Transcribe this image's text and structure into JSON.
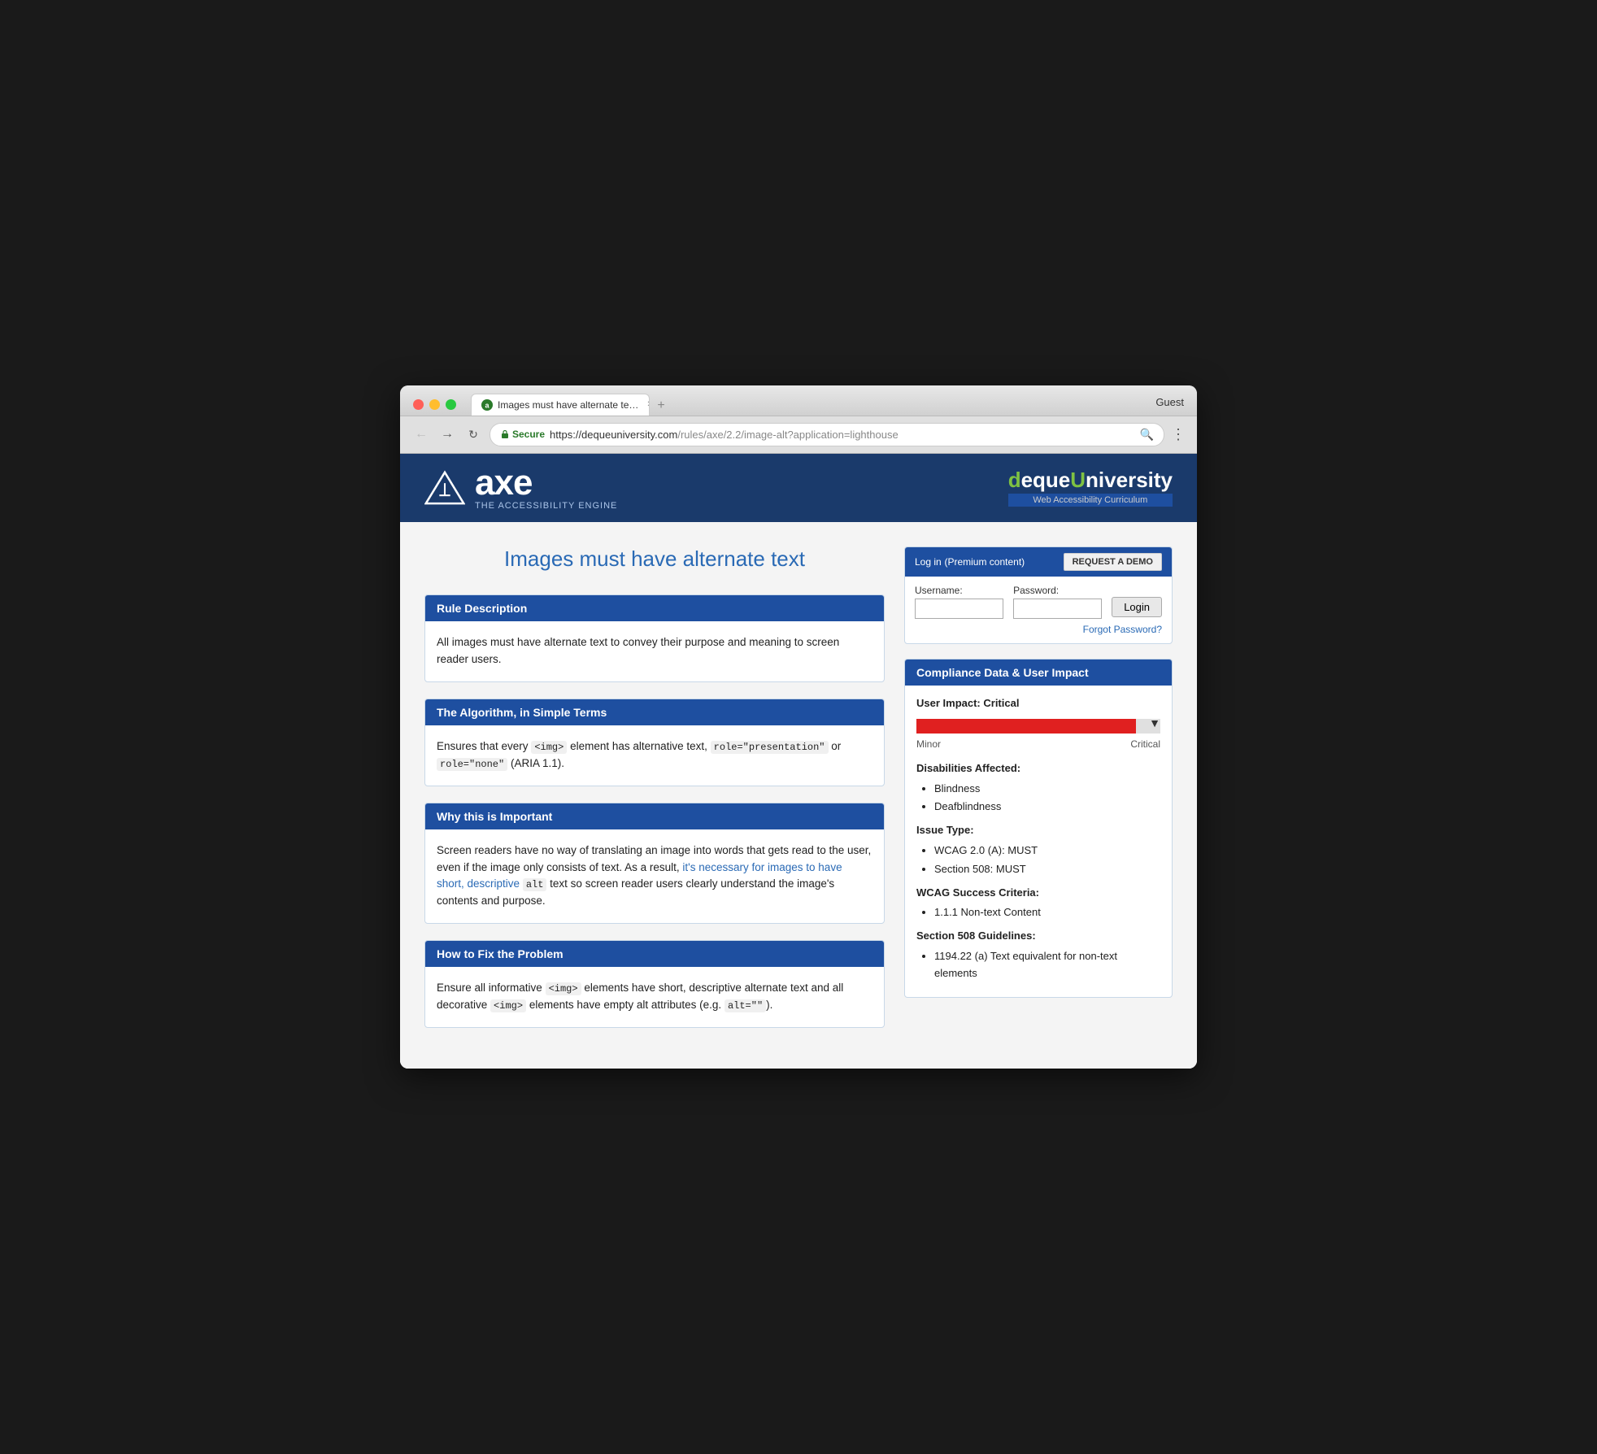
{
  "browser": {
    "tab_title": "Images must have alternate te…",
    "url_secure_label": "Secure",
    "url_full": "https://dequeuniversity.com/rules/axe/2.2/image-alt?application=lighthouse",
    "url_base": "https://dequeuniversity.com",
    "url_path": "/rules/axe/2.2/image-alt?application=lighthouse",
    "guest_label": "Guest",
    "back_btn": "←",
    "forward_btn": "→"
  },
  "header": {
    "axe_wordmark": "axe",
    "axe_subtitle": "THE ACCESSIBILITY ENGINE",
    "deque_wordmark_d": "d",
    "deque_wordmark_rest": "eque",
    "deque_university": "University",
    "deque_curriculum": "Web Accessibility Curriculum"
  },
  "page": {
    "title": "Images must have alternate text"
  },
  "login": {
    "title": "Log in",
    "premium_label": "(Premium content)",
    "request_demo_btn": "REQUEST A DEMO",
    "username_label": "Username:",
    "password_label": "Password:",
    "login_btn": "Login",
    "forgot_password": "Forgot Password?"
  },
  "sections": [
    {
      "id": "rule-description",
      "header": "Rule Description",
      "body": "All images must have alternate text to convey their purpose and meaning to screen reader users."
    },
    {
      "id": "algorithm",
      "header": "The Algorithm, in Simple Terms",
      "body_parts": [
        "Ensures that every ",
        "<img>",
        " element has alternative text, ",
        "role=\"presentation\"",
        " or ",
        "role=\"none\"",
        " (ARIA 1.1)."
      ],
      "body_text": "Ensures that every <img> element has alternative text, role=\"presentation\" or role=\"none\" (ARIA 1.1)."
    },
    {
      "id": "why-important",
      "header": "Why this is Important",
      "body_parts": [
        "Screen readers have no way of translating an image into words that gets read to the user, even if the image only consists of text. As a result, it's necessary for images to have short, descriptive ",
        "alt",
        " text so screen reader users clearly understand the image's contents and purpose."
      ],
      "body_text": "Screen readers have no way of translating an image into words that gets read to the user, even if the image only consists of text. As a result, it's necessary for images to have short, descriptive alt text so screen reader users clearly understand the image's contents and purpose."
    },
    {
      "id": "how-to-fix",
      "header": "How to Fix the Problem",
      "body_parts": [
        "Ensure all informative ",
        "<img>",
        " elements have short, descriptive alternate text and all decorative ",
        "<img>",
        " elements have empty alt attributes (e.g. ",
        "alt=\"\"",
        ")."
      ],
      "body_text": "Ensure all informative <img> elements have short, descriptive alternate text and all decorative <img> elements have empty alt attributes (e.g. alt=\"\")."
    }
  ],
  "compliance": {
    "header": "Compliance Data & User Impact",
    "user_impact_label": "User Impact:",
    "user_impact_value": "Critical",
    "impact_bar_fill_pct": 90,
    "impact_min_label": "Minor",
    "impact_max_label": "Critical",
    "disabilities_title": "Disabilities Affected:",
    "disabilities": [
      "Blindness",
      "Deafblindness"
    ],
    "issue_type_title": "Issue Type:",
    "issue_types": [
      "WCAG 2.0 (A): MUST",
      "Section 508: MUST"
    ],
    "wcag_title": "WCAG Success Criteria:",
    "wcag_items": [
      "1.1.1 Non-text Content"
    ],
    "section508_title": "Section 508 Guidelines:",
    "section508_items": [
      "1194.22 (a) Text equivalent for non-text elements"
    ]
  }
}
